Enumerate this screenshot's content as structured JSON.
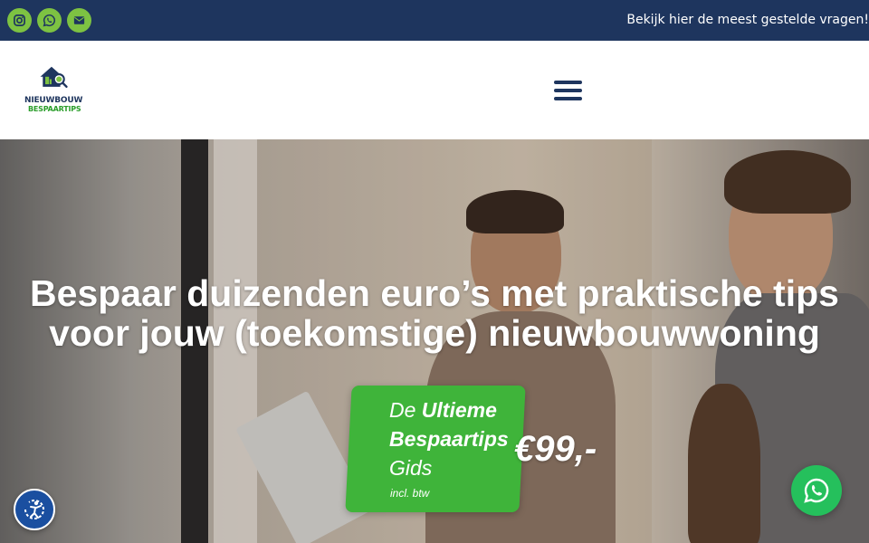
{
  "topbar": {
    "social": [
      {
        "icon": "instagram-icon"
      },
      {
        "icon": "whatsapp-icon"
      },
      {
        "icon": "envelope-icon"
      }
    ],
    "faq_link": "Bekijk hier de meest gestelde vragen!"
  },
  "header": {
    "logo_line1": "NIEUWBOUW",
    "logo_line2": "BESPAARTIPS",
    "menu_icon": "hamburger-menu-icon"
  },
  "hero": {
    "title_line1": "Bespaar duizenden euro’s met praktische tips",
    "title_line2": "voor jouw (toekomstige) nieuwbouwwoning",
    "promo": {
      "line1_prefix": "De ",
      "line1_bold": "Ultieme",
      "line2": "Bespaartips",
      "line3": "Gids",
      "vat": "incl. btw",
      "price": "€99,-"
    }
  },
  "floating": {
    "accessibility_icon": "accessibility-icon",
    "chat_icon": "whatsapp-icon"
  },
  "colors": {
    "topbar_bg": "#1e355e",
    "accent_green": "#7dc242",
    "promo_green": "#3fb43a",
    "whatsapp_green": "#25c05c",
    "accessibility_blue": "#1a4fa0"
  }
}
